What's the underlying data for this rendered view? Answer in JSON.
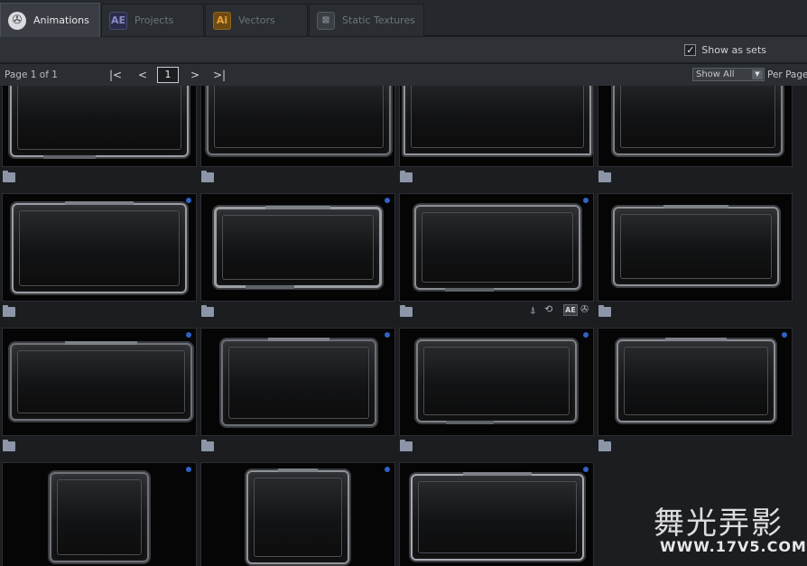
{
  "tabs": [
    {
      "label": "Animations",
      "icon": "film-reel-icon",
      "glyph": "✇",
      "active": true
    },
    {
      "label": "Projects",
      "icon": "after-effects-icon",
      "glyph": "AE",
      "active": false
    },
    {
      "label": "Vectors",
      "icon": "illustrator-icon",
      "glyph": "Ai",
      "active": false
    },
    {
      "label": "Static Textures",
      "icon": "texture-icon",
      "glyph": "⊠",
      "active": false
    }
  ],
  "toolbar": {
    "show_as_sets_label": "Show as sets",
    "show_as_sets_checked": true,
    "check_glyph": "✓"
  },
  "pagination": {
    "page_info": "Page 1 of 1",
    "first": "|<",
    "prev": "<",
    "current_page": "1",
    "next": ">",
    "last": ">|",
    "show_select_value": "Show All",
    "per_page_label": "Per Page"
  },
  "item_icons": {
    "pin": "⍋",
    "loop": "⟲",
    "ae": "AE",
    "reel": "✇"
  },
  "watermark": {
    "line1": "舞光弄影",
    "line2": "WWW.17V5.COM"
  },
  "colors": {
    "accent_dot": "#2f62c4",
    "folder": "#8c96a8",
    "tab_active": "#3a3e44"
  }
}
